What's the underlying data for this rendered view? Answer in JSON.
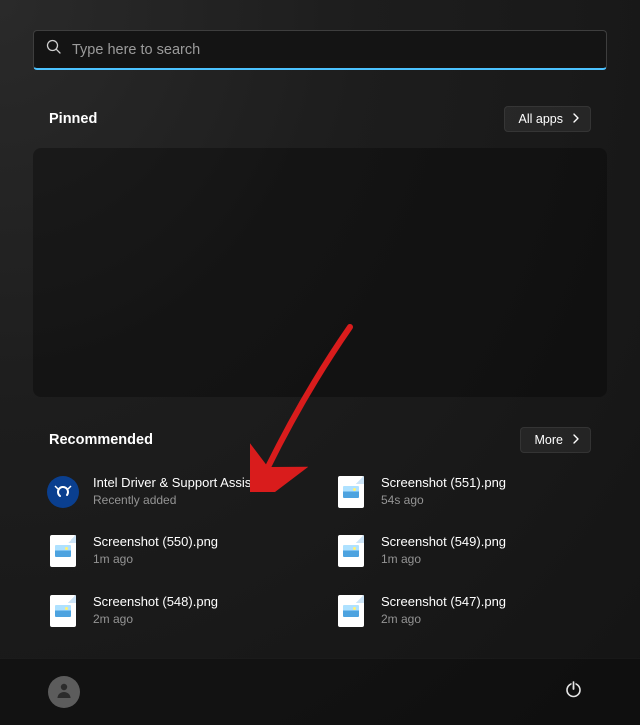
{
  "search": {
    "placeholder": "Type here to search"
  },
  "pinned": {
    "title": "Pinned",
    "allApps": "All apps"
  },
  "recommended": {
    "title": "Recommended",
    "more": "More",
    "items": [
      {
        "title": "Intel Driver & Support Assistant",
        "sub": "Recently added",
        "icon": "intel"
      },
      {
        "title": "Screenshot (551).png",
        "sub": "54s ago",
        "icon": "image"
      },
      {
        "title": "Screenshot (550).png",
        "sub": "1m ago",
        "icon": "image"
      },
      {
        "title": "Screenshot (549).png",
        "sub": "1m ago",
        "icon": "image"
      },
      {
        "title": "Screenshot (548).png",
        "sub": "2m ago",
        "icon": "image"
      },
      {
        "title": "Screenshot (547).png",
        "sub": "2m ago",
        "icon": "image"
      }
    ]
  }
}
